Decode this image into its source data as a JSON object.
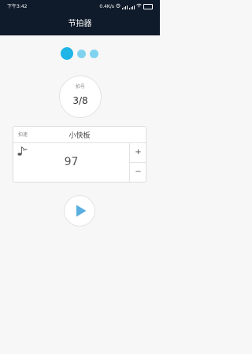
{
  "status_bar": {
    "time": "下午3:42",
    "net_speed": "0.4K/s",
    "battery_level": "48"
  },
  "header": {
    "title": "节拍器"
  },
  "pager": {
    "page_count": 3,
    "active_index": 0,
    "colors": {
      "active": "#1fb5e6",
      "inactive": "#7fd3ee"
    }
  },
  "beat": {
    "label": "拍号",
    "value": "3/8"
  },
  "tempo": {
    "label": "拍速",
    "name": "小快板",
    "note_symbol": "=",
    "value": "97",
    "increment_label": "+",
    "decrement_label": "−"
  },
  "player": {
    "icon": "play-icon",
    "accent_color": "#5aaee0"
  }
}
